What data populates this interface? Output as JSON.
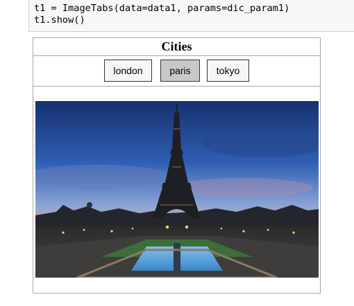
{
  "code": {
    "line1": "t1 = ImageTabs(data=data1, params=dic_param1)",
    "line2": "t1.show()"
  },
  "widget": {
    "title": "Cities",
    "tabs": [
      {
        "label": "london",
        "active": false
      },
      {
        "label": "paris",
        "active": true
      },
      {
        "label": "tokyo",
        "active": false
      }
    ],
    "image": {
      "subject": "eiffel-tower-at-dusk"
    }
  },
  "colors": {
    "active_tab": "#c8c8c8",
    "inactive_tab": "#f6f6f6",
    "border": "#a6a6a6",
    "code_bg": "#f7f7f7"
  }
}
